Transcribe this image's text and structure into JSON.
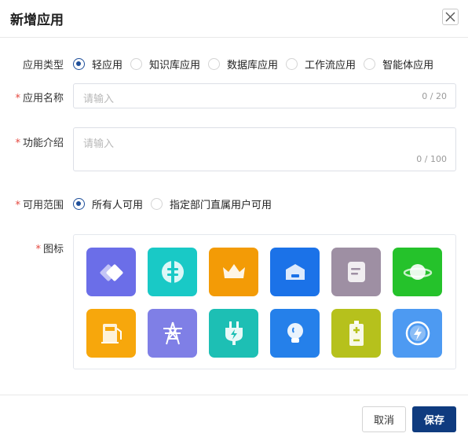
{
  "dialog": {
    "title": "新增应用"
  },
  "form": {
    "app_type": {
      "label": "应用类型",
      "options": [
        "轻应用",
        "知识库应用",
        "数据库应用",
        "工作流应用",
        "智能体应用"
      ],
      "selected": "轻应用"
    },
    "app_name": {
      "required_mark": "*",
      "label": "应用名称",
      "placeholder": "请输入",
      "value": "",
      "counter": "0 / 20"
    },
    "description": {
      "required_mark": "*",
      "label": "功能介绍",
      "placeholder": "请输入",
      "value": "",
      "counter": "0 / 100"
    },
    "scope": {
      "required_mark": "*",
      "label": "可用范围",
      "options": [
        "所有人可用",
        "指定部门直属用户可用"
      ],
      "selected": "所有人可用"
    },
    "icon": {
      "required_mark": "*",
      "label": "图标",
      "icons": [
        {
          "name": "diamond-cards",
          "color": "#6b6ee8"
        },
        {
          "name": "globe-plug",
          "color": "#19c9c6"
        },
        {
          "name": "crown",
          "color": "#f39b06"
        },
        {
          "name": "building-box",
          "color": "#1b72e8"
        },
        {
          "name": "document",
          "color": "#9e8fa3"
        },
        {
          "name": "planet",
          "color": "#25c22b"
        },
        {
          "name": "fuel-pump",
          "color": "#f7a70c"
        },
        {
          "name": "power-tower",
          "color": "#7f7fe6"
        },
        {
          "name": "plug-lightning",
          "color": "#1dbfb4"
        },
        {
          "name": "light-bulb",
          "color": "#2580ea"
        },
        {
          "name": "battery",
          "color": "#b6c11c"
        },
        {
          "name": "compass-lightning",
          "color": "#4d9af2"
        }
      ]
    }
  },
  "footer": {
    "cancel_label": "取消",
    "save_label": "保存"
  },
  "colors": {
    "primary": "#0f3b7f",
    "required": "#e5483f",
    "border": "#dcdfe6"
  }
}
